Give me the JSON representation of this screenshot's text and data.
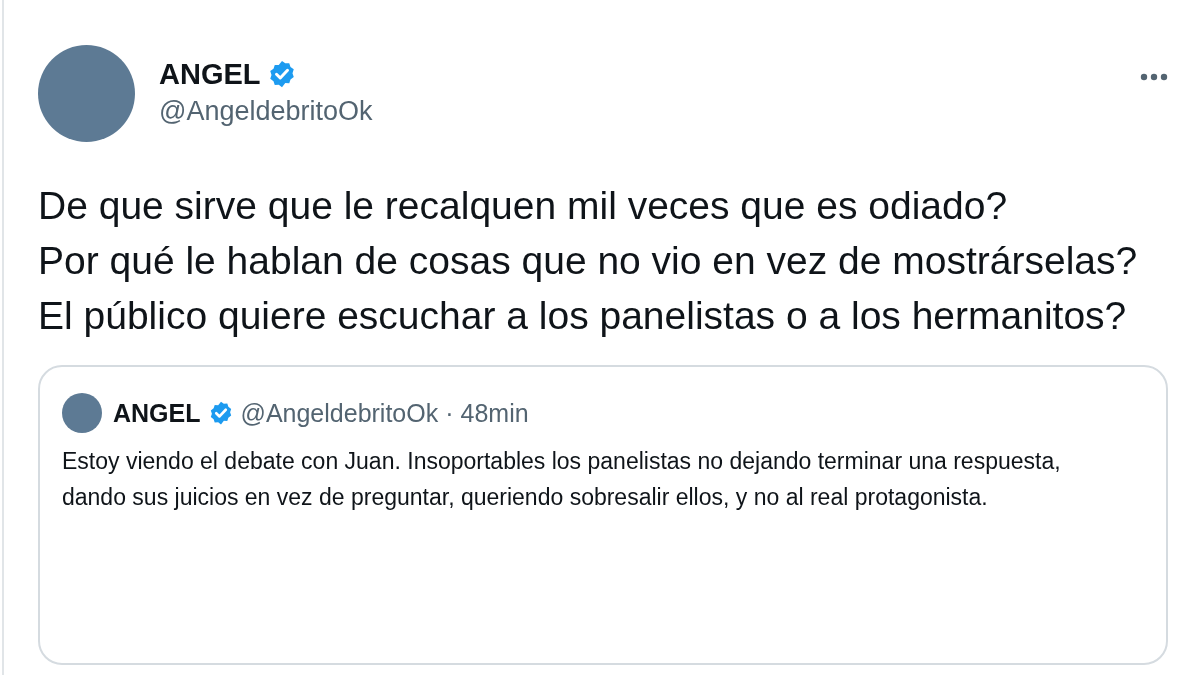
{
  "tweet": {
    "author": {
      "name": "ANGEL",
      "verified": true,
      "handle": "@AngeldebritoOk"
    },
    "text": "De que sirve que le recalquen mil veces que es odiado?\nPor qué le hablan de cosas que no vio en vez de mostrárselas?\nEl público quiere escuchar a los panelistas o a los hermanitos?",
    "quoted": {
      "author": {
        "name": "ANGEL",
        "verified": true,
        "handle": "@AngeldebritoOk"
      },
      "separator": "·",
      "time": "48min",
      "text": "Estoy viendo el debate con Juan. Insoportables los panelistas no dejando terminar una respuesta, dando sus juicios en vez de preguntar, queriendo sobresalir ellos, y no al real protagonista."
    }
  }
}
